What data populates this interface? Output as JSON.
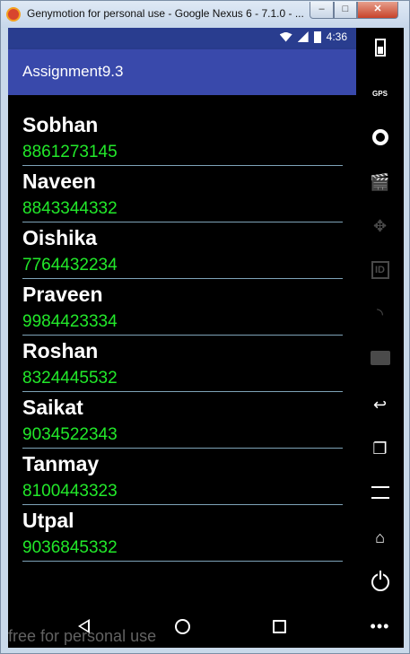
{
  "window": {
    "title": "Genymotion for personal use - Google Nexus 6 - 7.1.0 - ...",
    "minimize_glyph": "–",
    "maximize_glyph": "□",
    "close_glyph": "✕"
  },
  "status_bar": {
    "time": "4:36"
  },
  "app_bar": {
    "title": "Assignment9.3",
    "color": "#3949ab"
  },
  "contacts": [
    {
      "name": "Sobhan",
      "phone": "8861273145"
    },
    {
      "name": "Naveen",
      "phone": "8843344332"
    },
    {
      "name": "Oishika",
      "phone": "7764432234"
    },
    {
      "name": "Praveen",
      "phone": "9984423334"
    },
    {
      "name": "Roshan",
      "phone": "8324445532"
    },
    {
      "name": "Saikat",
      "phone": "9034522343"
    },
    {
      "name": "Tanmay",
      "phone": "8100443323"
    },
    {
      "name": "Utpal",
      "phone": "9036845332"
    }
  ],
  "colors": {
    "phone_text": "#22e82a",
    "divider": "#7ea3b8",
    "status_bar": "#293d8f"
  },
  "watermark": "free for personal use",
  "toolbar": {
    "gps_label": "GPS",
    "id_label": "ID",
    "more_glyph": "•••",
    "icons": [
      "battery-icon",
      "gps-icon",
      "webcam-icon",
      "capture-icon",
      "dpad-icon",
      "identifier-icon",
      "cast-icon",
      "sms-icon",
      "back-icon",
      "recent-apps-icon",
      "menu-icon",
      "home-icon",
      "power-icon",
      "more-icon"
    ]
  }
}
